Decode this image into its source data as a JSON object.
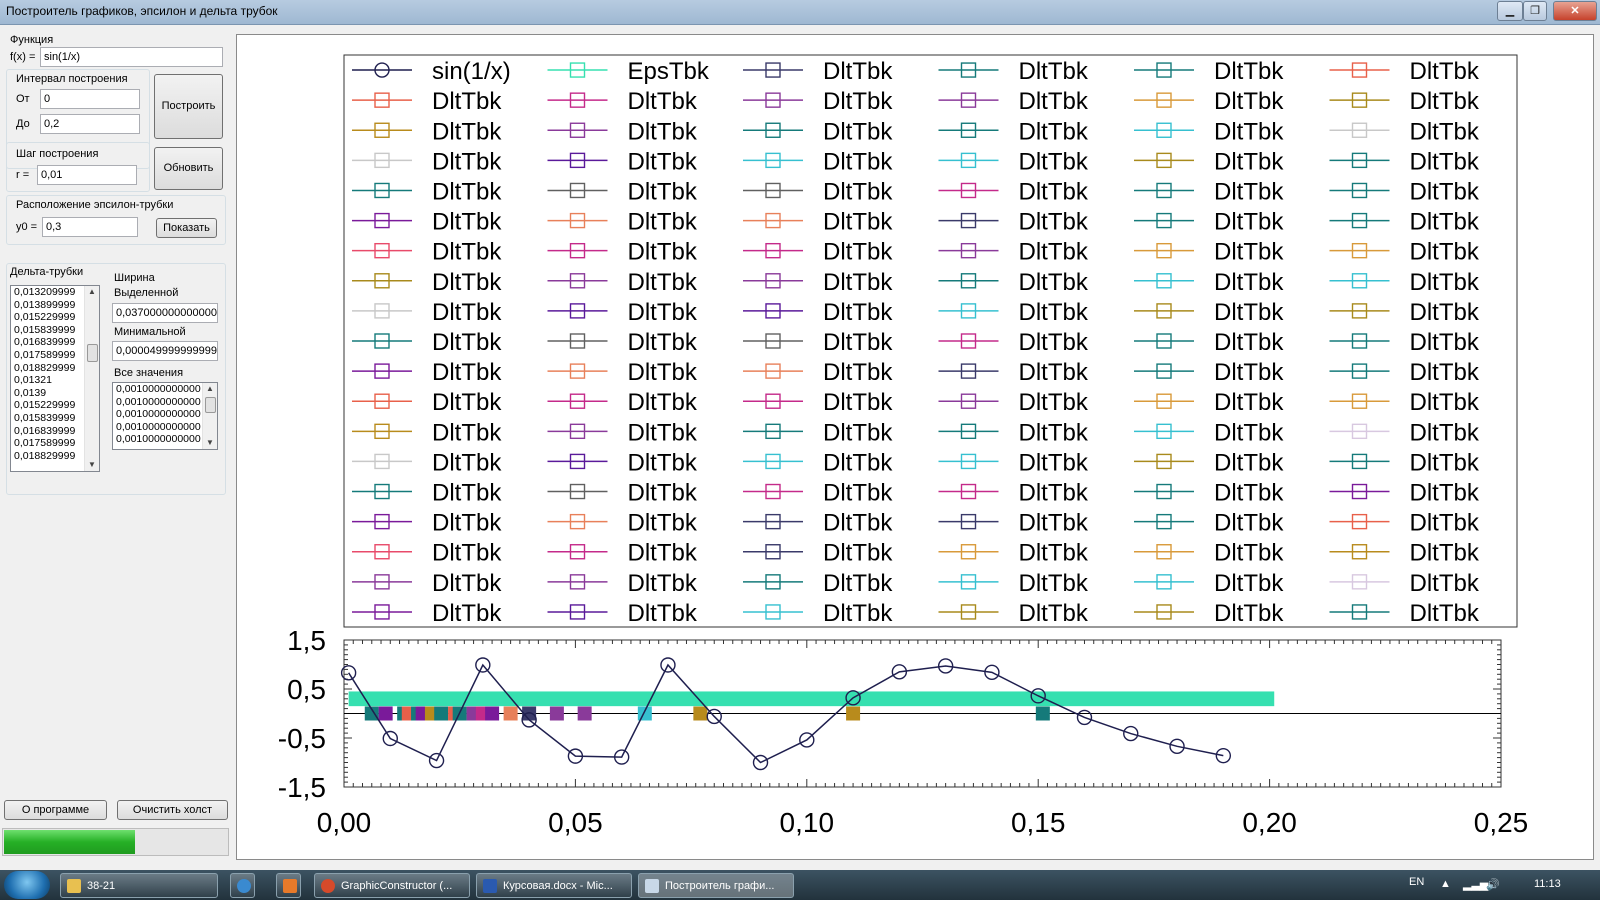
{
  "window": {
    "title": "Построитель графиков, эпсилон и дельта трубок"
  },
  "controls": {
    "function_group": "Функция",
    "fx_label": "f(x) =",
    "fx_value": "sin(1/x)",
    "interval_group": "Интервал построения",
    "from_label": "От",
    "from_value": "0",
    "to_label": "До",
    "to_value": "0,2",
    "build_button": "Построить",
    "step_group": "Шаг построения",
    "r_label": "r =",
    "r_value": "0,01",
    "refresh_button": "Обновить",
    "eps_group": "Расположение эпсилон-трубки",
    "y0_label": "y0 =",
    "y0_value": "0,3",
    "show_button": "Показать",
    "delta_group": "Дельта-трубки",
    "delta_list": [
      "0,013209999",
      "0,013899999",
      "0,015229999",
      "0,015839999",
      "0,016839999",
      "0,017589999",
      "0,018829999",
      "0,01321",
      "0,0139",
      "0,015229999",
      "0,015839999",
      "0,016839999",
      "0,017589999",
      "0,018829999"
    ],
    "width_group": "Ширина",
    "selected_label": "Выделенной",
    "selected_value": "0,037000000000000",
    "min_label": "Минимальной",
    "min_value": "0,0000499999999998",
    "all_label": "Все значения",
    "all_list": [
      "0,0010000000000",
      "0,0010000000000",
      "0,0010000000000",
      "0,0010000000000",
      "0,0010000000000"
    ],
    "about_button": "О программе",
    "clear_button": "Очистить холст",
    "progress": 0.58
  },
  "legend_colors": {
    "eps": "#36e0b0",
    "cols": [
      [
        "#1f1f4f",
        "#e8604a",
        "#b88b1c",
        "#c8c8c8",
        "#157a7a",
        "#7a1a9a",
        "#e84a6a",
        "#a88a1c",
        "#c8c8c8",
        "#157a7a",
        "#7a1a9a",
        "#e8604a",
        "#b88b1c",
        "#c8c8c8",
        "#157a7a",
        "#7a1a9a",
        "#e84a6a",
        "#8a3a9a",
        "#7a1a9a"
      ],
      [
        "#36e0b0",
        "#c42a8a",
        "#8a3a9a",
        "#5a1a9a",
        "#606060",
        "#e8805a",
        "#c42a8a",
        "#8a3a9a",
        "#5a1a9a",
        "#606060",
        "#e8805a",
        "#c42a8a",
        "#8a3a9a",
        "#5a1a9a",
        "#606060",
        "#e8805a",
        "#c42a8a",
        "#8a3a9a",
        "#5a1a9a"
      ],
      [
        "#3a3a6a",
        "#8a3a9a",
        "#157a7a",
        "#36c0d0",
        "#606060",
        "#e8805a",
        "#c42a8a",
        "#8a3a9a",
        "#5a1a9a",
        "#606060",
        "#e8805a",
        "#c42a8a",
        "#157a7a",
        "#36c0d0",
        "#c42a8a",
        "#3a3a6a",
        "#3a3a6a",
        "#157a7a",
        "#36c0d0"
      ],
      [
        "#157a7a",
        "#8a3a9a",
        "#157a7a",
        "#36c0d0",
        "#c42a8a",
        "#3a3a6a",
        "#8a3a9a",
        "#157a7a",
        "#36c0d0",
        "#c42a8a",
        "#3a3a6a",
        "#8a3a9a",
        "#157a7a",
        "#36c0d0",
        "#c42a8a",
        "#3a3a6a",
        "#d89a3a",
        "#36c0d0",
        "#a88a1c"
      ],
      [
        "#157a7a",
        "#d89a3a",
        "#36c0d0",
        "#a88a1c",
        "#157a7a",
        "#157a7a",
        "#d89a3a",
        "#36c0d0",
        "#a88a1c",
        "#157a7a",
        "#157a7a",
        "#d89a3a",
        "#36c0d0",
        "#a88a1c",
        "#157a7a",
        "#157a7a",
        "#d89a3a",
        "#36c0d0",
        "#a88a1c"
      ],
      [
        "#e8604a",
        "#a88a1c",
        "#c8c8c8",
        "#157a7a",
        "#157a7a",
        "#157a7a",
        "#d89a3a",
        "#36c0d0",
        "#a88a1c",
        "#157a7a",
        "#157a7a",
        "#d89a3a",
        "#d8c8e0",
        "#157a7a",
        "#7a1a9a",
        "#e8604a",
        "#b88b1c",
        "#d8c8e0",
        "#157a7a"
      ]
    ]
  },
  "chart_data": {
    "type": "line",
    "series": [
      {
        "name": "sin(1/x)",
        "color": "#1f1f4f",
        "marker": "circle",
        "x": [
          0.001,
          0.01,
          0.02,
          0.03,
          0.04,
          0.05,
          0.06,
          0.07,
          0.08,
          0.09,
          0.1,
          0.11,
          0.12,
          0.13,
          0.14,
          0.15,
          0.16,
          0.17,
          0.18,
          0.19
        ],
        "y": [
          0.83,
          -0.51,
          -0.96,
          0.99,
          -0.13,
          -0.87,
          -0.89,
          0.99,
          -0.06,
          -1.0,
          -0.54,
          0.32,
          0.85,
          0.97,
          0.84,
          0.36,
          -0.08,
          -0.41,
          -0.67,
          -0.86
        ]
      },
      {
        "name": "EpsTbk",
        "color": "#36e0b0",
        "band": [
          0.001,
          0.201,
          0.15,
          0.45
        ]
      }
    ],
    "legend_labels": {
      "main": "sin(1/x)",
      "eps": "EpsTbk",
      "delta": "DltTbk"
    },
    "delta_markers": [
      {
        "x": 0.006,
        "c": "#157a7a"
      },
      {
        "x": 0.009,
        "c": "#7a1a9a"
      },
      {
        "x": 0.013,
        "c": "#157a7a"
      },
      {
        "x": 0.014,
        "c": "#e8604a"
      },
      {
        "x": 0.016,
        "c": "#157a7a"
      },
      {
        "x": 0.017,
        "c": "#7a1a9a"
      },
      {
        "x": 0.019,
        "c": "#b88b1c"
      },
      {
        "x": 0.021,
        "c": "#157a7a"
      },
      {
        "x": 0.024,
        "c": "#e8604a"
      },
      {
        "x": 0.025,
        "c": "#157a7a"
      },
      {
        "x": 0.028,
        "c": "#8a3a9a"
      },
      {
        "x": 0.03,
        "c": "#c42a8a"
      },
      {
        "x": 0.032,
        "c": "#7a1a9a"
      },
      {
        "x": 0.036,
        "c": "#e8805a"
      },
      {
        "x": 0.04,
        "c": "#3a3a6a"
      },
      {
        "x": 0.046,
        "c": "#8a3a9a"
      },
      {
        "x": 0.052,
        "c": "#8a3a9a"
      },
      {
        "x": 0.065,
        "c": "#36c0d0"
      },
      {
        "x": 0.077,
        "c": "#b88b1c"
      },
      {
        "x": 0.11,
        "c": "#b88b1c"
      },
      {
        "x": 0.151,
        "c": "#157a7a"
      }
    ],
    "xlim": [
      0.0,
      0.25
    ],
    "ylim": [
      -1.5,
      1.5
    ],
    "xticks": [
      "0,00",
      "0,05",
      "0,10",
      "0,15",
      "0,20",
      "0,25"
    ],
    "yticks": [
      "1,5",
      "0,5",
      "-0,5",
      "-1,5"
    ]
  },
  "taskbar": {
    "items": [
      "38-21",
      "GraphicConstructor (...",
      "Курсовая.docx - Mic...",
      "Построитель графи..."
    ],
    "lang": "EN",
    "time": "11:13"
  }
}
